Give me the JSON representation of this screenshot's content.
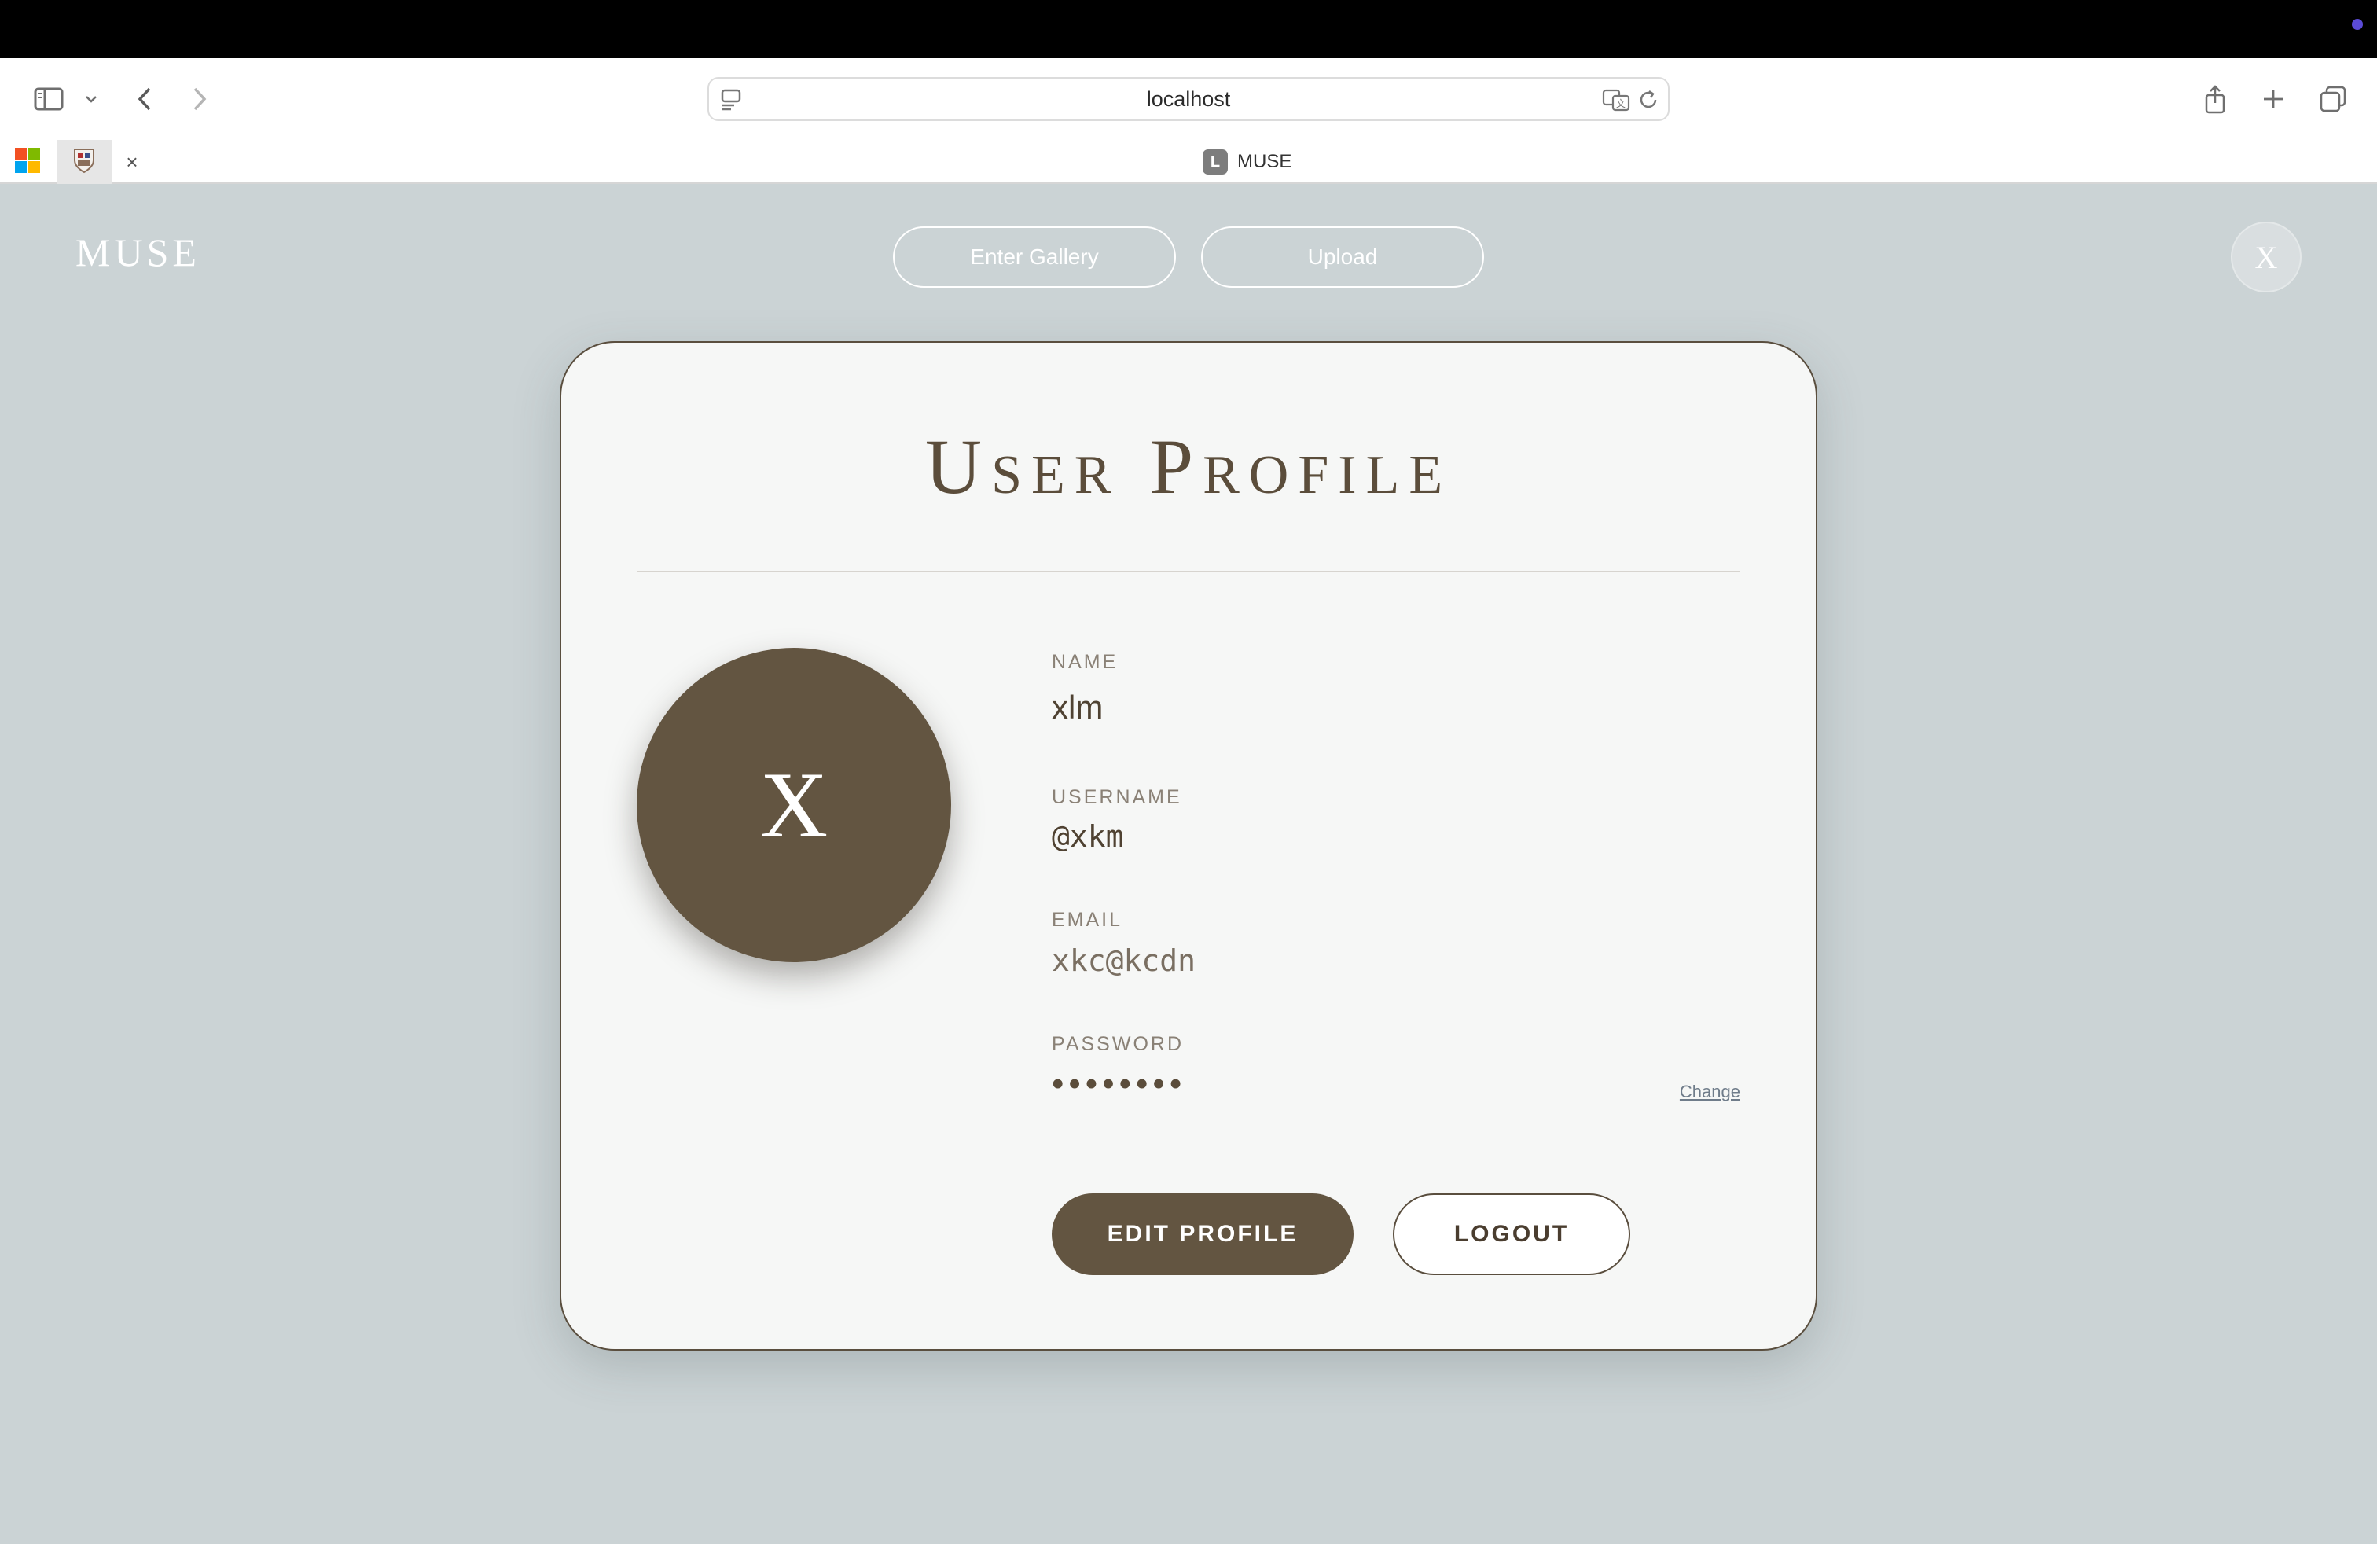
{
  "browser": {
    "url": "localhost",
    "tab_title": "MUSE",
    "tab_favicon_letter": "L",
    "tab_close": "×",
    "icons": {
      "sidebar": "sidebar-icon",
      "back": "chevron-left-icon",
      "forward": "chevron-right-icon",
      "translate": "translate-icon",
      "reload": "reload-icon",
      "share": "share-icon",
      "new_tab": "plus-icon",
      "tab_overview": "tabs-icon"
    }
  },
  "app": {
    "brand": "MUSE",
    "nav": {
      "gallery": "Enter Gallery",
      "upload": "Upload"
    },
    "user_initial": "X"
  },
  "profile": {
    "title": "User Profile",
    "avatar_initial": "X",
    "name_label": "NAME",
    "name": "xlm",
    "username_label": "USERNAME",
    "username": "@xkm",
    "email_label": "EMAIL",
    "email": "xkc@kcdn",
    "password_label": "PASSWORD",
    "password_mask": "••••••••",
    "change_link": "Change",
    "edit_button": "EDIT PROFILE",
    "logout_button": "LOGOUT"
  },
  "colors": {
    "background": "#cbd3d5",
    "card": "#f6f7f6",
    "accent": "#635541",
    "text_dark": "#4f4232"
  }
}
